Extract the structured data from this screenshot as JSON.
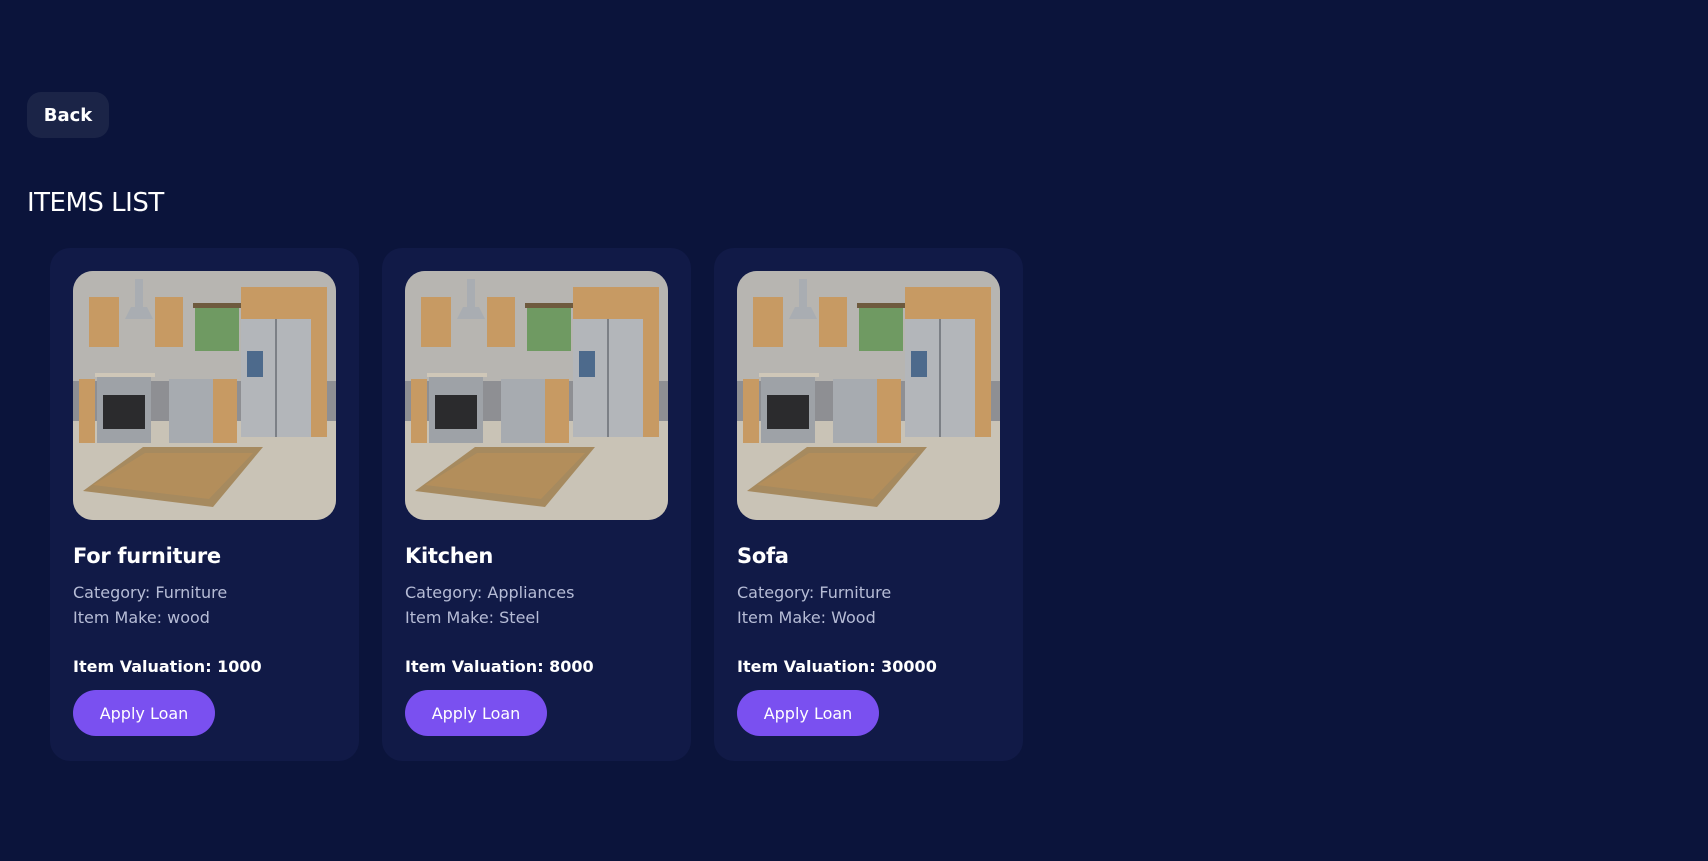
{
  "header": {
    "back_label": "Back"
  },
  "page": {
    "title": "ITEMS LIST"
  },
  "colors": {
    "background": "#0b143b",
    "card": "#111a47",
    "accent": "#7a50f0"
  },
  "items": [
    {
      "name": "For furniture",
      "category": "Category: Furniture",
      "make": "Item Make: wood",
      "valuation": "Item Valuation: 1000",
      "button_label": "Apply Loan",
      "image": "kitchen-image"
    },
    {
      "name": "Kitchen",
      "category": "Category: Appliances",
      "make": "Item Make: Steel",
      "valuation": "Item Valuation: 8000",
      "button_label": "Apply Loan",
      "image": "kitchen-image"
    },
    {
      "name": "Sofa",
      "category": "Category: Furniture",
      "make": "Item Make: Wood",
      "valuation": "Item Valuation: 30000",
      "button_label": "Apply Loan",
      "image": "kitchen-image"
    }
  ]
}
